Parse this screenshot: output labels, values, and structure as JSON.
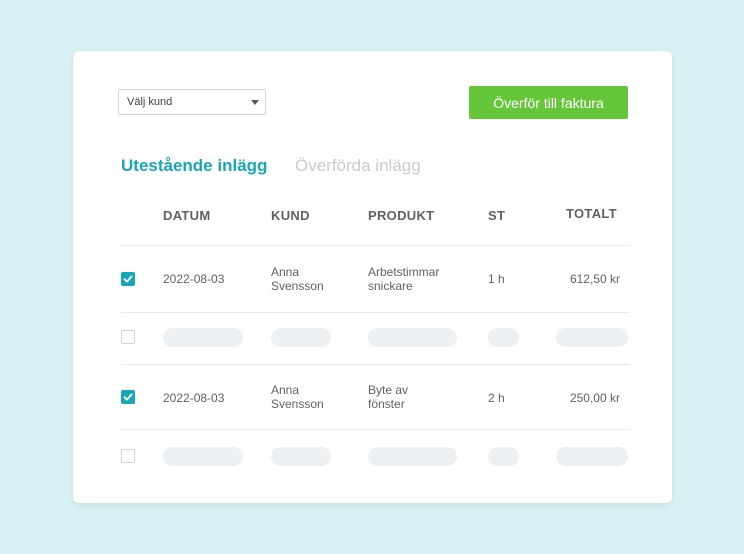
{
  "toolbar": {
    "customer_select": "Välj kund",
    "transfer_button": "Överför till faktura"
  },
  "tabs": [
    {
      "label": "Utestående inlägg",
      "active": true
    },
    {
      "label": "Överförda inlägg",
      "active": false
    }
  ],
  "table": {
    "columns": [
      "DATUM",
      "KUND",
      "PRODUKT",
      "ST",
      "TOTALT"
    ],
    "rows": [
      {
        "checked": true,
        "date": "2022-08-03",
        "customer_line1": "Anna",
        "customer_line2": "Svensson",
        "product_line1": "Arbetstimmar",
        "product_line2": "snickare",
        "qty": "1 h",
        "total": "612,50 kr"
      },
      {
        "checked": false,
        "placeholder": true
      },
      {
        "checked": true,
        "date": "2022-08-03",
        "customer_line1": "Anna",
        "customer_line2": "Svensson",
        "product_line1": "Byte av",
        "product_line2": "fönster",
        "qty": "2 h",
        "total": "250,00 kr"
      },
      {
        "checked": false,
        "placeholder": true
      }
    ]
  },
  "colors": {
    "background": "#d8f1f4",
    "accent": "#17a8b8",
    "button": "#66c63a"
  },
  "icons": {
    "dropdown": "chevron-down-icon",
    "check": "check-icon"
  }
}
